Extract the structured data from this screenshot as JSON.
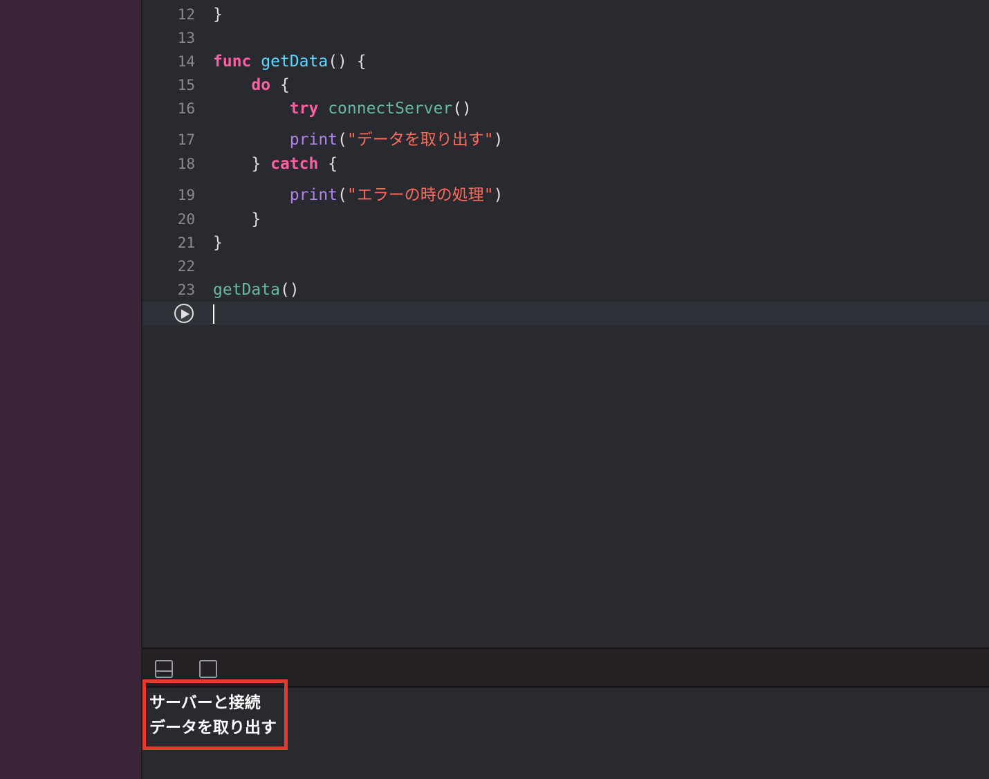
{
  "editor": {
    "lines": [
      {
        "num": "12",
        "tokens": [
          {
            "t": "}",
            "c": "plain"
          }
        ]
      },
      {
        "num": "13",
        "tokens": []
      },
      {
        "num": "14",
        "tokens": [
          {
            "t": "func",
            "c": "kw"
          },
          {
            "t": " ",
            "c": "plain"
          },
          {
            "t": "getData",
            "c": "fndecl"
          },
          {
            "t": "() {",
            "c": "plain"
          }
        ]
      },
      {
        "num": "15",
        "tokens": [
          {
            "t": "    ",
            "c": "plain"
          },
          {
            "t": "do",
            "c": "kw"
          },
          {
            "t": " {",
            "c": "plain"
          }
        ]
      },
      {
        "num": "16",
        "tokens": [
          {
            "t": "        ",
            "c": "plain"
          },
          {
            "t": "try",
            "c": "kw"
          },
          {
            "t": " ",
            "c": "plain"
          },
          {
            "t": "connectServer",
            "c": "fn"
          },
          {
            "t": "()",
            "c": "plain"
          }
        ]
      },
      {
        "num": "17",
        "tokens": [
          {
            "t": "        ",
            "c": "plain"
          },
          {
            "t": "print",
            "c": "purple"
          },
          {
            "t": "(",
            "c": "plain"
          },
          {
            "t": "\"データを取り出す\"",
            "c": "str"
          },
          {
            "t": ")",
            "c": "plain"
          }
        ]
      },
      {
        "num": "18",
        "tokens": [
          {
            "t": "    } ",
            "c": "plain"
          },
          {
            "t": "catch",
            "c": "kw"
          },
          {
            "t": " {",
            "c": "plain"
          }
        ]
      },
      {
        "num": "19",
        "tokens": [
          {
            "t": "        ",
            "c": "plain"
          },
          {
            "t": "print",
            "c": "purple"
          },
          {
            "t": "(",
            "c": "plain"
          },
          {
            "t": "\"エラーの時の処理\"",
            "c": "str"
          },
          {
            "t": ")",
            "c": "plain"
          }
        ]
      },
      {
        "num": "20",
        "tokens": [
          {
            "t": "    }",
            "c": "plain"
          }
        ]
      },
      {
        "num": "21",
        "tokens": [
          {
            "t": "}",
            "c": "plain"
          }
        ]
      },
      {
        "num": "22",
        "tokens": []
      },
      {
        "num": "23",
        "tokens": [
          {
            "t": "getData",
            "c": "fn"
          },
          {
            "t": "()",
            "c": "plain"
          }
        ]
      }
    ]
  },
  "console": {
    "output": [
      "サーバーと接続",
      "データを取り出す"
    ]
  },
  "icons": {
    "run": "play-circle-icon",
    "hide_panel": "panel-bottom-icon",
    "show_panel": "panel-square-icon"
  },
  "colors": {
    "highlight_border": "#e8392b",
    "keyword": "#fc5fa3",
    "string": "#fc6a5d",
    "function": "#67b7a4",
    "print": "#b281eb"
  }
}
